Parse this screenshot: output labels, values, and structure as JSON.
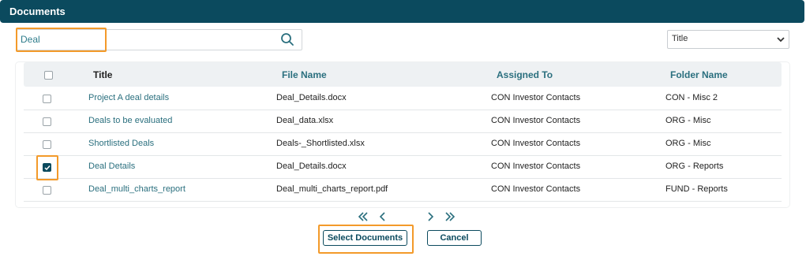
{
  "header": {
    "title": "Documents"
  },
  "search": {
    "value": "Deal"
  },
  "sort": {
    "selected": "Title"
  },
  "table": {
    "columns": [
      "Title",
      "File Name",
      "Assigned To",
      "Folder Name"
    ],
    "rows": [
      {
        "title": "Project A deal details",
        "file_name": "Deal_Details.docx",
        "assigned_to": "CON Investor Contacts",
        "folder": "CON - Misc 2",
        "checked": false
      },
      {
        "title": "Deals to be evaluated",
        "file_name": "Deal_data.xlsx",
        "assigned_to": "CON Investor Contacts",
        "folder": "ORG - Misc",
        "checked": false
      },
      {
        "title": "Shortlisted Deals",
        "file_name": "Deals-_Shortlisted.xlsx",
        "assigned_to": "CON Investor Contacts",
        "folder": "ORG - Misc",
        "checked": false
      },
      {
        "title": "Deal Details",
        "file_name": "Deal_Details.docx",
        "assigned_to": "CON Investor Contacts",
        "folder": "ORG - Reports",
        "checked": true
      },
      {
        "title": "Deal_multi_charts_report",
        "file_name": "Deal_multi_charts_report.pdf",
        "assigned_to": "CON Investor Contacts",
        "folder": "FUND - Reports",
        "checked": false
      }
    ]
  },
  "actions": {
    "select_label": "Select Documents",
    "cancel_label": "Cancel"
  },
  "colors": {
    "header": "#0b4a5e",
    "accent_text": "#2a6f7e",
    "highlight": "#f39a2a"
  }
}
